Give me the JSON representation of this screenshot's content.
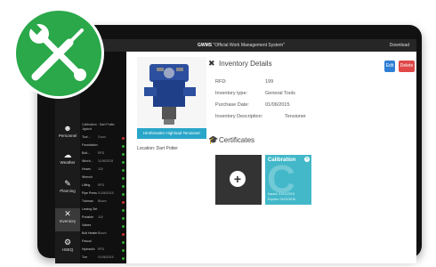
{
  "topbar": {
    "title_main": "GWMS",
    "title_sub": "Official Work Management System",
    "download": "Download"
  },
  "sidebar": {
    "items": [
      {
        "label": "Personnel",
        "icon": "people-icon"
      },
      {
        "label": "Weather",
        "icon": "weather-icon"
      },
      {
        "label": "Planning",
        "icon": "planning-icon"
      },
      {
        "label": "Inventory",
        "icon": "tools-icon"
      },
      {
        "label": "HSEQ",
        "icon": "gear-icon"
      }
    ]
  },
  "list": {
    "header": "Calibration · Dart Potter Jigshot",
    "rows": [
      {
        "name": "Tool ...",
        "status": "Good",
        "color": "#c33"
      },
      {
        "name": "Foundation",
        "status": "",
        "color": "#3a3"
      },
      {
        "name": "Bolt...",
        "status": "RFD",
        "color": "#3a3"
      },
      {
        "name": "Winch...",
        "status": "11/06/2015",
        "color": "#3a3"
      },
      {
        "name": "Hoses",
        "status": "118",
        "color": "#3a3"
      },
      {
        "name": "Wrench",
        "status": "",
        "color": "#3a3"
      },
      {
        "name": "Lifting",
        "status": "RFD",
        "color": "#3a3"
      },
      {
        "name": "Pipe Press",
        "status": "01/06/2015",
        "color": "#3a3"
      },
      {
        "name": "Tubman",
        "status": "Blown",
        "color": "#c33"
      },
      {
        "name": "Lewing Set",
        "status": "",
        "color": "#3a3"
      },
      {
        "name": "Portable",
        "status": "118",
        "color": "#3a3"
      },
      {
        "name": "Valves",
        "status": "",
        "color": "#3a3"
      },
      {
        "name": "Bolt Heater",
        "status": "Blown",
        "color": "#c33"
      },
      {
        "name": "Pascal",
        "status": "",
        "color": "#3a3"
      },
      {
        "name": "Hydraulic",
        "status": "RFD",
        "color": "#3a3"
      },
      {
        "name": "Torr",
        "status": "01/06/2015",
        "color": "#3a3"
      }
    ]
  },
  "tool": {
    "caption": "Hirshmaster Highload Tensioner",
    "location": "Location: Dart Potter"
  },
  "inventory": {
    "title": "Inventory Details",
    "edit_label": "Edit",
    "delete_label": "Delete",
    "fields": [
      {
        "label": "RFD:",
        "value": "199"
      },
      {
        "label": "Inventory type:",
        "value": "General Tools"
      },
      {
        "label": "Purchase Date:",
        "value": "01/06/2015"
      },
      {
        "label": "Inventory Description:",
        "value": "Tensioner"
      }
    ]
  },
  "certificates": {
    "title": "Certificates",
    "cards": [
      {
        "name": "Calibration",
        "big_letter": "C",
        "issued": "Issued: 01/01/2015",
        "expires": "Expires: 01/01/2016"
      }
    ]
  },
  "colors": {
    "accent": "#29a6c9",
    "badge": "#2aa84a",
    "edit": "#2f7fd6",
    "delete": "#e04848"
  }
}
